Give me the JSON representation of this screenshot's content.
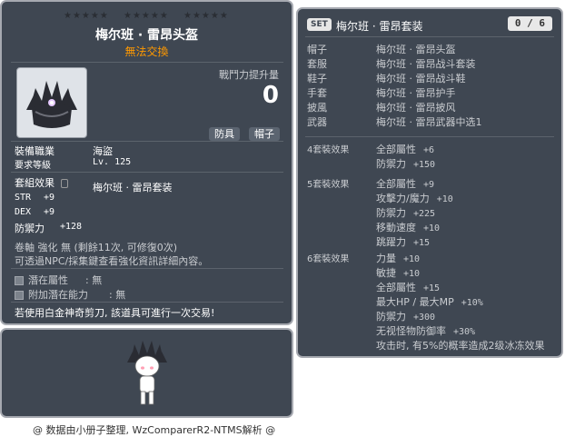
{
  "item_id": "01003294",
  "stars": [
    "★★★★★",
    "★★★★★",
    "★★★★★"
  ],
  "item": {
    "name": "梅尔班 · 雷昂头盔",
    "trade_status": "無法交換",
    "power_label": "戰鬥力提升量",
    "power_value": "0",
    "tags": [
      "防具",
      "帽子"
    ],
    "job_label": "裝備職業",
    "job_value": "海盜",
    "level_label": "要求等級",
    "level_value": "Lv. 125",
    "set_effect_label": "套組效果",
    "set_effect_name": "梅尔班 · 雷昂套装",
    "stats": [
      {
        "name": "STR",
        "value": "+9"
      },
      {
        "name": "DEX",
        "value": "+9"
      },
      {
        "name": "防禦力",
        "value": "+128"
      }
    ],
    "scroll_line": "卷軸 強化 無 (剩餘11次, 可修復0次)",
    "npc_line": "可透過NPC/採集鍵查看強化資訊詳細內容。",
    "potential_label": "潛在屬性",
    "potential_value": ": 無",
    "add_potential_label": "附加潛在能力",
    "add_potential_value": ": 無",
    "scissors_note": "若使用白金神奇剪刀, 該道具可進行一次交易!"
  },
  "footer": "@ 数据由小册子整理, WzComparerR2-NTMS解析 @",
  "set_panel": {
    "badge": "SET",
    "title": "梅尔班 · 雷昂套装",
    "count": "0 / 6",
    "pieces": [
      {
        "type": "帽子",
        "name": "梅尔班 · 雷昂头盔"
      },
      {
        "type": "套服",
        "name": "梅尔班 · 雷昂战斗套装"
      },
      {
        "type": "鞋子",
        "name": "梅尔班 · 雷昂战斗鞋"
      },
      {
        "type": "手套",
        "name": "梅尔班 · 雷昂护手"
      },
      {
        "type": "披風",
        "name": "梅尔班 · 雷昂披风"
      },
      {
        "type": "武器",
        "name": "梅尔班 · 雷昂武器中选1"
      }
    ],
    "effects": [
      {
        "label": "4套裝效果",
        "lines": [
          {
            "name": "全部屬性",
            "value": "+6"
          },
          {
            "name": "防禦力",
            "value": "+150"
          }
        ]
      },
      {
        "label": "5套裝效果",
        "lines": [
          {
            "name": "全部屬性",
            "value": "+9"
          },
          {
            "name": "攻擊力/魔力",
            "value": "+10"
          },
          {
            "name": "防禦力",
            "value": "+225"
          },
          {
            "name": "移動速度",
            "value": "+10"
          },
          {
            "name": "跳躍力",
            "value": "+15"
          }
        ]
      },
      {
        "label": "6套裝效果",
        "lines": [
          {
            "name": "力量",
            "value": "+10"
          },
          {
            "name": "敏捷",
            "value": "+10"
          },
          {
            "name": "全部屬性",
            "value": "+15"
          },
          {
            "name": "最大HP / 最大MP",
            "value": "+10%"
          },
          {
            "name": "防禦力",
            "value": "+300"
          },
          {
            "name": "无视怪物防御率",
            "value": "+30%"
          },
          {
            "name": "攻击时, 有5%的概率造成2级冰冻效果",
            "value": ""
          }
        ]
      }
    ]
  },
  "colors": {
    "panel": "#3f4752",
    "border": "#a6a9b0",
    "orange": "#ff9900",
    "text": "#eeeeee"
  }
}
